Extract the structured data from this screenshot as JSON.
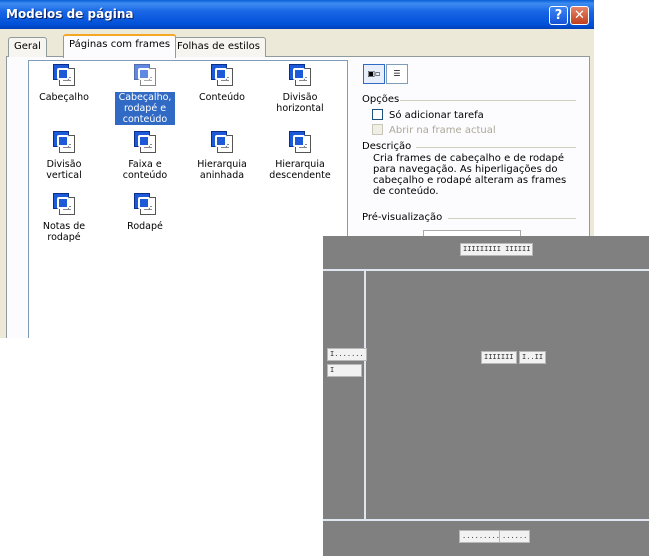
{
  "window": {
    "title": "Modelos de página",
    "help_label": "?",
    "close_label": "✕"
  },
  "tabs": [
    {
      "label": "Geral"
    },
    {
      "label": "Páginas com frames"
    },
    {
      "label": "Folhas de estilos"
    }
  ],
  "templates": [
    {
      "label": "Cabeçalho",
      "selected": false
    },
    {
      "label": "Cabeçalho, rodapé e conteúdo",
      "selected": true
    },
    {
      "label": "Conteúdo",
      "selected": false
    },
    {
      "label": "Divisão horizontal",
      "selected": false
    },
    {
      "label": "Divisão vertical",
      "selected": false
    },
    {
      "label": "Faixa e conteúdo",
      "selected": false
    },
    {
      "label": "Hierarquia aninhada",
      "selected": false
    },
    {
      "label": "Hierarquia descendente",
      "selected": false
    },
    {
      "label": "Notas de rodapé",
      "selected": false
    },
    {
      "label": "Rodapé",
      "selected": false
    }
  ],
  "view_buttons": [
    {
      "name": "large-icons-view",
      "icon": "large-icons-icon",
      "active": true
    },
    {
      "name": "details-view",
      "icon": "list-details-icon",
      "active": false
    }
  ],
  "options": {
    "heading": "Opções",
    "add_task": {
      "label": "Só adicionar tarefa",
      "checked": false,
      "enabled": true
    },
    "open_in_frame": {
      "label": "Abrir na frame actual",
      "checked": false,
      "enabled": false
    }
  },
  "description": {
    "heading": "Descrição",
    "text": "Cria frames de cabeçalho e de rodapé para navegação. As hiperligações do cabeçalho e rodapé alteram as frames de conteúdo."
  },
  "preview": {
    "heading": "Pré-visualização",
    "header_text": "IIIIIIIII IIIIII",
    "left_text_1": "I.......",
    "left_text_2": "I",
    "center_text_1": "IIIIIII",
    "center_text_2": "I..II",
    "footer_text_1": ".........",
    "footer_text_2": "......",
    "background": "#808080",
    "divider_color": "#dfe6f0"
  },
  "colors": {
    "titlebar": "#0a5fd9",
    "selection": "#316ac5",
    "dialog_bg": "#ece9d8"
  }
}
